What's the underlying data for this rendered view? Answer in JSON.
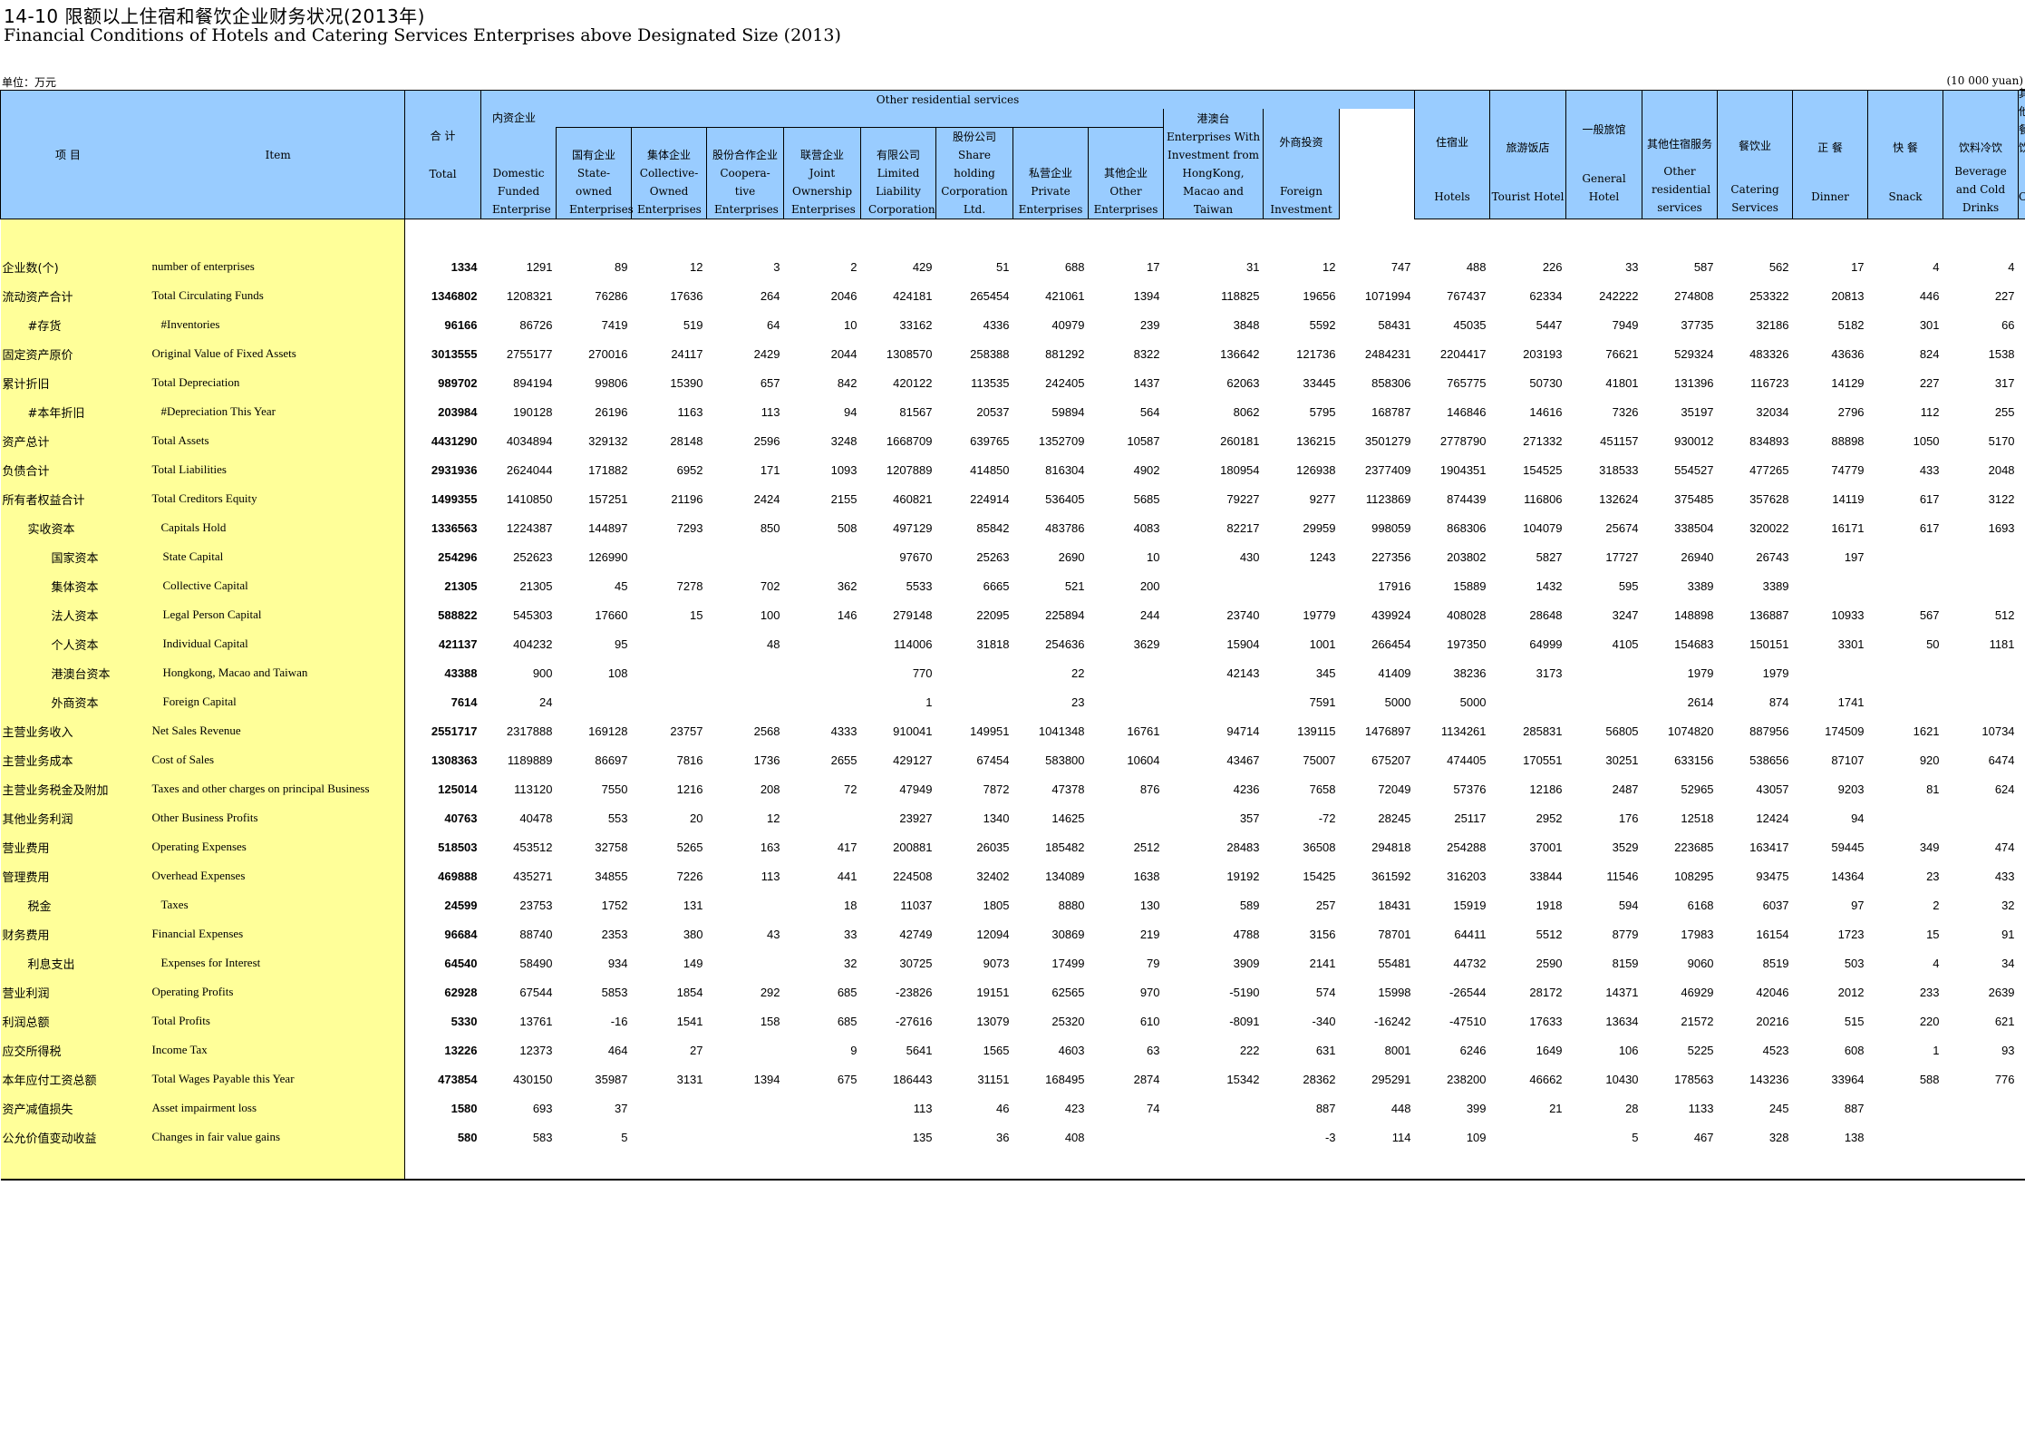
{
  "title": {
    "zh": "14-10  限额以上住宿和餐饮企业财务状况(2013年)",
    "en": "Financial Conditions of Hotels and Catering Services Enterprises above Designated Size (2013)"
  },
  "unit": {
    "zh": "单位：万元",
    "en": "(10 000 yuan)"
  },
  "header": {
    "item_zh": "项  目",
    "item_en": "Item",
    "total_zh": "合 计",
    "total_en": "Total",
    "group_other_residential": "Other residential services",
    "domestic_zh": "内资企业",
    "domestic_en": "Domestic Funded Enterprise",
    "state_zh": "国有企业",
    "state_en": "State-owned Enterprises",
    "collective_zh": "集体企业",
    "collective_en": "Collective-Owned Enterprises",
    "coop_zh": "股份合作企业",
    "coop_en": "Coopera-tive Enterprises",
    "joint_zh": "联营企业",
    "joint_en": "Joint Ownership Enterprises",
    "ltd_zh": "有限公司",
    "ltd_en": "Limited Liability Corporation",
    "share_zh": "股份公司",
    "share_en": "Share holding Corporation Ltd.",
    "private_zh": "私营企业",
    "private_en": "Private Enterprises",
    "other_ent_zh": "其他企业",
    "other_ent_en": "Other Enterprises",
    "hmt_zh": "港澳台",
    "hmt_en": "Enterprises With Investment from HongKong, Macao and Taiwan",
    "foreign_zh": "外商投资",
    "foreign_en": "Foreign Investment",
    "hotels_zh": "住宿业",
    "hotels_en": "Hotels",
    "tourist_zh": "旅游饭店",
    "tourist_en": "Tourist Hotel",
    "general_zh": "一般旅馆",
    "general_en": "General Hotel",
    "other_res_zh": "其他住宿服务",
    "other_res_en": "Other residential services",
    "catering_zh": "餐饮业",
    "catering_en": "Catering Services",
    "dinner_zh": "正 餐",
    "dinner_en": "Dinner",
    "snack_zh": "快 餐",
    "snack_en": "Snack",
    "bev_zh": "饮料冷饮",
    "bev_en": "Beverage and Cold Drinks",
    "others_zh": "其他餐饮",
    "others_en": "Others"
  },
  "rows": [
    {
      "zh": "企业数(个)",
      "en": "number of enterprises",
      "indent": 0,
      "v": [
        "1334",
        "1291",
        "89",
        "12",
        "3",
        "2",
        "429",
        "51",
        "688",
        "17",
        "31",
        "12",
        "747",
        "488",
        "226",
        "33",
        "587",
        "562",
        "17",
        "4",
        "4"
      ]
    },
    {
      "zh": "流动资产合计",
      "en": "Total Circulating Funds",
      "indent": 0,
      "v": [
        "1346802",
        "1208321",
        "76286",
        "17636",
        "264",
        "2046",
        "424181",
        "265454",
        "421061",
        "1394",
        "118825",
        "19656",
        "1071994",
        "767437",
        "62334",
        "242222",
        "274808",
        "253322",
        "20813",
        "446",
        "227"
      ]
    },
    {
      "zh": "#存货",
      "en": "#Inventories",
      "indent": 1,
      "v": [
        "96166",
        "86726",
        "7419",
        "519",
        "64",
        "10",
        "33162",
        "4336",
        "40979",
        "239",
        "3848",
        "5592",
        "58431",
        "45035",
        "5447",
        "7949",
        "37735",
        "32186",
        "5182",
        "301",
        "66"
      ]
    },
    {
      "zh": "固定资产原价",
      "en": "Original Value of Fixed Assets",
      "indent": 0,
      "v": [
        "3013555",
        "2755177",
        "270016",
        "24117",
        "2429",
        "2044",
        "1308570",
        "258388",
        "881292",
        "8322",
        "136642",
        "121736",
        "2484231",
        "2204417",
        "203193",
        "76621",
        "529324",
        "483326",
        "43636",
        "824",
        "1538"
      ]
    },
    {
      "zh": "累计折旧",
      "en": "Total Depreciation",
      "indent": 0,
      "v": [
        "989702",
        "894194",
        "99806",
        "15390",
        "657",
        "842",
        "420122",
        "113535",
        "242405",
        "1437",
        "62063",
        "33445",
        "858306",
        "765775",
        "50730",
        "41801",
        "131396",
        "116723",
        "14129",
        "227",
        "317"
      ]
    },
    {
      "zh": "#本年折旧",
      "en": "#Depreciation This Year",
      "indent": 1,
      "v": [
        "203984",
        "190128",
        "26196",
        "1163",
        "113",
        "94",
        "81567",
        "20537",
        "59894",
        "564",
        "8062",
        "5795",
        "168787",
        "146846",
        "14616",
        "7326",
        "35197",
        "32034",
        "2796",
        "112",
        "255"
      ]
    },
    {
      "zh": "资产总计",
      "en": "Total Assets",
      "indent": 0,
      "v": [
        "4431290",
        "4034894",
        "329132",
        "28148",
        "2596",
        "3248",
        "1668709",
        "639765",
        "1352709",
        "10587",
        "260181",
        "136215",
        "3501279",
        "2778790",
        "271332",
        "451157",
        "930012",
        "834893",
        "88898",
        "1050",
        "5170"
      ]
    },
    {
      "zh": "负债合计",
      "en": "Total Liabilities",
      "indent": 0,
      "v": [
        "2931936",
        "2624044",
        "171882",
        "6952",
        "171",
        "1093",
        "1207889",
        "414850",
        "816304",
        "4902",
        "180954",
        "126938",
        "2377409",
        "1904351",
        "154525",
        "318533",
        "554527",
        "477265",
        "74779",
        "433",
        "2048"
      ]
    },
    {
      "zh": "所有者权益合计",
      "en": "Total Creditors Equity",
      "indent": 0,
      "v": [
        "1499355",
        "1410850",
        "157251",
        "21196",
        "2424",
        "2155",
        "460821",
        "224914",
        "536405",
        "5685",
        "79227",
        "9277",
        "1123869",
        "874439",
        "116806",
        "132624",
        "375485",
        "357628",
        "14119",
        "617",
        "3122"
      ]
    },
    {
      "zh": "实收资本",
      "en": "Capitals Hold",
      "indent": 1,
      "v": [
        "1336563",
        "1224387",
        "144897",
        "7293",
        "850",
        "508",
        "497129",
        "85842",
        "483786",
        "4083",
        "82217",
        "29959",
        "998059",
        "868306",
        "104079",
        "25674",
        "338504",
        "320022",
        "16171",
        "617",
        "1693"
      ]
    },
    {
      "zh": "国家资本",
      "en": "State Capital",
      "indent": 2,
      "v": [
        "254296",
        "252623",
        "126990",
        "",
        "",
        "",
        "97670",
        "25263",
        "2690",
        "10",
        "430",
        "1243",
        "227356",
        "203802",
        "5827",
        "17727",
        "26940",
        "26743",
        "197",
        "",
        ""
      ]
    },
    {
      "zh": "集体资本",
      "en": "Collective Capital",
      "indent": 2,
      "v": [
        "21305",
        "21305",
        "45",
        "7278",
        "702",
        "362",
        "5533",
        "6665",
        "521",
        "200",
        "",
        "",
        "17916",
        "15889",
        "1432",
        "595",
        "3389",
        "3389",
        "",
        "",
        ""
      ]
    },
    {
      "zh": "法人资本",
      "en": "Legal Person Capital",
      "indent": 2,
      "v": [
        "588822",
        "545303",
        "17660",
        "15",
        "100",
        "146",
        "279148",
        "22095",
        "225894",
        "244",
        "23740",
        "19779",
        "439924",
        "408028",
        "28648",
        "3247",
        "148898",
        "136887",
        "10933",
        "567",
        "512"
      ]
    },
    {
      "zh": "个人资本",
      "en": "Individual Capital",
      "indent": 2,
      "v": [
        "421137",
        "404232",
        "95",
        "",
        "48",
        "",
        "114006",
        "31818",
        "254636",
        "3629",
        "15904",
        "1001",
        "266454",
        "197350",
        "64999",
        "4105",
        "154683",
        "150151",
        "3301",
        "50",
        "1181"
      ]
    },
    {
      "zh": "港澳台资本",
      "en": "Hongkong, Macao and Taiwan",
      "indent": 2,
      "v": [
        "43388",
        "900",
        "108",
        "",
        "",
        "",
        "770",
        "",
        "22",
        "",
        "42143",
        "345",
        "41409",
        "38236",
        "3173",
        "",
        "1979",
        "1979",
        "",
        "",
        ""
      ]
    },
    {
      "zh": "外商资本",
      "en": "Foreign Capital",
      "indent": 2,
      "v": [
        "7614",
        "24",
        "",
        "",
        "",
        "",
        "1",
        "",
        "23",
        "",
        "",
        "7591",
        "5000",
        "5000",
        "",
        "",
        "2614",
        "874",
        "1741",
        "",
        ""
      ]
    },
    {
      "zh": "主营业务收入",
      "en": "Net Sales Revenue",
      "indent": 0,
      "v": [
        "2551717",
        "2317888",
        "169128",
        "23757",
        "2568",
        "4333",
        "910041",
        "149951",
        "1041348",
        "16761",
        "94714",
        "139115",
        "1476897",
        "1134261",
        "285831",
        "56805",
        "1074820",
        "887956",
        "174509",
        "1621",
        "10734"
      ]
    },
    {
      "zh": "主营业务成本",
      "en": "Cost of Sales",
      "indent": 0,
      "v": [
        "1308363",
        "1189889",
        "86697",
        "7816",
        "1736",
        "2655",
        "429127",
        "67454",
        "583800",
        "10604",
        "43467",
        "75007",
        "675207",
        "474405",
        "170551",
        "30251",
        "633156",
        "538656",
        "87107",
        "920",
        "6474"
      ]
    },
    {
      "zh": "主营业务税金及附加",
      "en": "Taxes and other charges on principal Business",
      "indent": 0,
      "v": [
        "125014",
        "113120",
        "7550",
        "1216",
        "208",
        "72",
        "47949",
        "7872",
        "47378",
        "876",
        "4236",
        "7658",
        "72049",
        "57376",
        "12186",
        "2487",
        "52965",
        "43057",
        "9203",
        "81",
        "624"
      ]
    },
    {
      "zh": "其他业务利润",
      "en": "Other Business Profits",
      "indent": 0,
      "v": [
        "40763",
        "40478",
        "553",
        "20",
        "12",
        "",
        "23927",
        "1340",
        "14625",
        "",
        "357",
        "-72",
        "28245",
        "25117",
        "2952",
        "176",
        "12518",
        "12424",
        "94",
        "",
        ""
      ]
    },
    {
      "zh": "营业费用",
      "en": "Operating Expenses",
      "indent": 0,
      "v": [
        "518503",
        "453512",
        "32758",
        "5265",
        "163",
        "417",
        "200881",
        "26035",
        "185482",
        "2512",
        "28483",
        "36508",
        "294818",
        "254288",
        "37001",
        "3529",
        "223685",
        "163417",
        "59445",
        "349",
        "474"
      ]
    },
    {
      "zh": "管理费用",
      "en": "Overhead Expenses",
      "indent": 0,
      "v": [
        "469888",
        "435271",
        "34855",
        "7226",
        "113",
        "441",
        "224508",
        "32402",
        "134089",
        "1638",
        "19192",
        "15425",
        "361592",
        "316203",
        "33844",
        "11546",
        "108295",
        "93475",
        "14364",
        "23",
        "433"
      ]
    },
    {
      "zh": "税金",
      "en": "Taxes",
      "indent": 1,
      "v": [
        "24599",
        "23753",
        "1752",
        "131",
        "",
        "18",
        "11037",
        "1805",
        "8880",
        "130",
        "589",
        "257",
        "18431",
        "15919",
        "1918",
        "594",
        "6168",
        "6037",
        "97",
        "2",
        "32"
      ]
    },
    {
      "zh": "财务费用",
      "en": "Financial Expenses",
      "indent": 0,
      "v": [
        "96684",
        "88740",
        "2353",
        "380",
        "43",
        "33",
        "42749",
        "12094",
        "30869",
        "219",
        "4788",
        "3156",
        "78701",
        "64411",
        "5512",
        "8779",
        "17983",
        "16154",
        "1723",
        "15",
        "91"
      ]
    },
    {
      "zh": "利息支出",
      "en": "Expenses for Interest",
      "indent": 1,
      "v": [
        "64540",
        "58490",
        "934",
        "149",
        "",
        "32",
        "30725",
        "9073",
        "17499",
        "79",
        "3909",
        "2141",
        "55481",
        "44732",
        "2590",
        "8159",
        "9060",
        "8519",
        "503",
        "4",
        "34"
      ]
    },
    {
      "zh": "营业利润",
      "en": "Operating Profits",
      "indent": 0,
      "v": [
        "62928",
        "67544",
        "5853",
        "1854",
        "292",
        "685",
        "-23826",
        "19151",
        "62565",
        "970",
        "-5190",
        "574",
        "15998",
        "-26544",
        "28172",
        "14371",
        "46929",
        "42046",
        "2012",
        "233",
        "2639"
      ]
    },
    {
      "zh": "利润总额",
      "en": "Total Profits",
      "indent": 0,
      "v": [
        "5330",
        "13761",
        "-16",
        "1541",
        "158",
        "685",
        "-27616",
        "13079",
        "25320",
        "610",
        "-8091",
        "-340",
        "-16242",
        "-47510",
        "17633",
        "13634",
        "21572",
        "20216",
        "515",
        "220",
        "621"
      ]
    },
    {
      "zh": "应交所得税",
      "en": "Income Tax",
      "indent": 0,
      "v": [
        "13226",
        "12373",
        "464",
        "27",
        "",
        "9",
        "5641",
        "1565",
        "4603",
        "63",
        "222",
        "631",
        "8001",
        "6246",
        "1649",
        "106",
        "5225",
        "4523",
        "608",
        "1",
        "93"
      ]
    },
    {
      "zh": "本年应付工资总额",
      "en": "Total Wages Payable this Year",
      "indent": 0,
      "v": [
        "473854",
        "430150",
        "35987",
        "3131",
        "1394",
        "675",
        "186443",
        "31151",
        "168495",
        "2874",
        "15342",
        "28362",
        "295291",
        "238200",
        "46662",
        "10430",
        "178563",
        "143236",
        "33964",
        "588",
        "776"
      ]
    },
    {
      "zh": "资产减值损失",
      "en": "Asset impairment loss",
      "indent": 0,
      "v": [
        "1580",
        "693",
        "37",
        "",
        "",
        "",
        "113",
        "46",
        "423",
        "74",
        "",
        "887",
        "448",
        "399",
        "21",
        "28",
        "1133",
        "245",
        "887",
        "",
        ""
      ]
    },
    {
      "zh": "公允价值变动收益",
      "en": "Changes in fair value gains",
      "indent": 0,
      "v": [
        "580",
        "583",
        "5",
        "",
        "",
        "",
        "135",
        "36",
        "408",
        "",
        "",
        "-3",
        "114",
        "109",
        "",
        "5",
        "467",
        "328",
        "138",
        "",
        ""
      ]
    }
  ]
}
